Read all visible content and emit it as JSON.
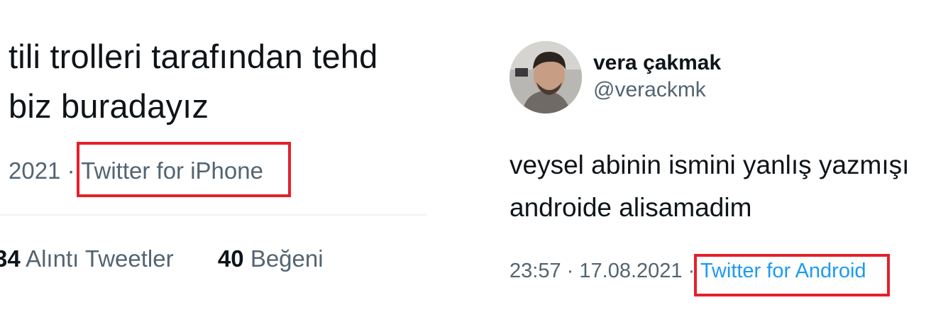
{
  "left_tweet": {
    "text_line1": "tili trolleri tarafından tehd",
    "text_line2": "biz buradayız",
    "date_fragment": "2021",
    "separator": "·",
    "source": "Twitter for iPhone",
    "stats": {
      "quote_count_fragment": "34",
      "quote_label": "Alıntı Tweetler",
      "like_count": "40",
      "like_label": "Beğeni"
    }
  },
  "right_tweet": {
    "display_name": "vera çakmak",
    "handle": "@verackmk",
    "text_line1": "veysel abinin ismini yanlış yazmışı",
    "text_line2": "androide alisamadim",
    "time": "23:57",
    "separator": "·",
    "date": "17.08.2021",
    "source": "Twitter for Android"
  },
  "colors": {
    "highlight_box": "#e5202b",
    "link": "#1d9bf0",
    "secondary_text": "#536471",
    "primary_text": "#0f1419"
  }
}
